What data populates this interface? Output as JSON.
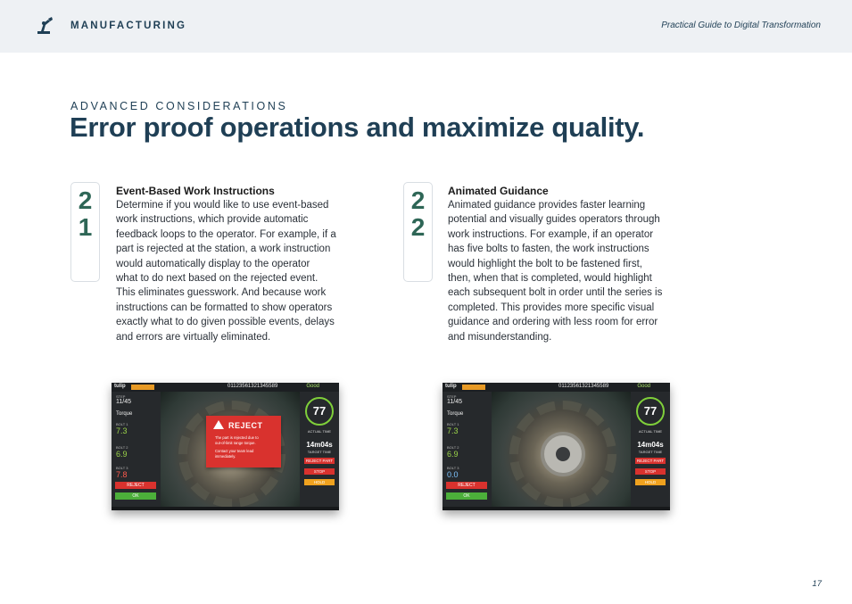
{
  "header": {
    "brand": "MANUFACTURING",
    "guide_title": "Practical Guide to Digital Transformation"
  },
  "section": {
    "eyebrow": "ADVANCED CONSIDERATIONS",
    "title": "Error proof operations and maximize quality."
  },
  "features": [
    {
      "number_digits": [
        "2",
        "1"
      ],
      "title": "Event-Based Work Instructions",
      "body": [
        "Determine if you would like to use event-based",
        "work instructions, which provide automatic",
        "feedback loops to the operator. For example, if a",
        "part is rejected at the station, a work instruction",
        "would automatically display to the operator",
        "what to do next based on the rejected event.",
        "This eliminates guesswork. And because work",
        "instructions can be formatted to show operators",
        "exactly what to do given possible events, delays",
        "and errors are virtually eliminated."
      ]
    },
    {
      "number_digits": [
        "2",
        "2"
      ],
      "title": "Animated Guidance",
      "body": [
        "Animated guidance provides faster learning",
        "potential and visually guides operators through",
        "work instructions. For example, if an operator",
        "has five bolts to fasten, the work instructions",
        "would highlight the bolt to be fastened first,",
        "then, when that is completed, would highlight",
        "each subsequent bolt in order until the series is",
        "completed. This provides more specific visual",
        "guidance and ordering with less room for error",
        "and misunderstanding."
      ]
    }
  ],
  "screens": [
    {
      "serial": "01123561321345589",
      "status": "Good",
      "step": "11/45",
      "description": "Torque",
      "bolts": [
        {
          "label": "BOLT 1",
          "value": "7.3"
        },
        {
          "label": "BOLT 2",
          "value": "6.9"
        },
        {
          "label": "BOLT 3",
          "value": "7.8"
        }
      ],
      "reject_btn": "REJECT",
      "ok_btn": "OK",
      "dial": "77",
      "actual_label": "ACTUAL TIME",
      "target_value": "14m04s",
      "target_label": "TARGET TIME",
      "side_buttons": [
        "REJECT PART",
        "STOP",
        "HOLD"
      ],
      "popup": {
        "title": "REJECT",
        "lines": [
          "The part is rejected due to",
          "out-of-limit range torque.",
          "",
          "Contact your team lead",
          "immediately."
        ]
      }
    },
    {
      "serial": "01123561321345589",
      "status": "Good",
      "step": "11/45",
      "description": "Torque",
      "bolts": [
        {
          "label": "BOLT 1",
          "value": "7.3"
        },
        {
          "label": "BOLT 2",
          "value": "6.9"
        },
        {
          "label": "BOLT 3",
          "value": "0.0"
        }
      ],
      "reject_btn": "REJECT",
      "ok_btn": "OK",
      "dial": "77",
      "actual_label": "ACTUAL TIME",
      "target_value": "14m04s",
      "target_label": "TARGET TIME",
      "side_buttons": [
        "REJECT PART",
        "STOP",
        "HOLD"
      ]
    }
  ],
  "page_number": "17",
  "colors": {
    "navy": "#1f3f55",
    "accent_green": "#2e6656",
    "reject_red": "#d9322e",
    "ok_green": "#4caf3a",
    "hold_orange": "#f0a21f"
  }
}
